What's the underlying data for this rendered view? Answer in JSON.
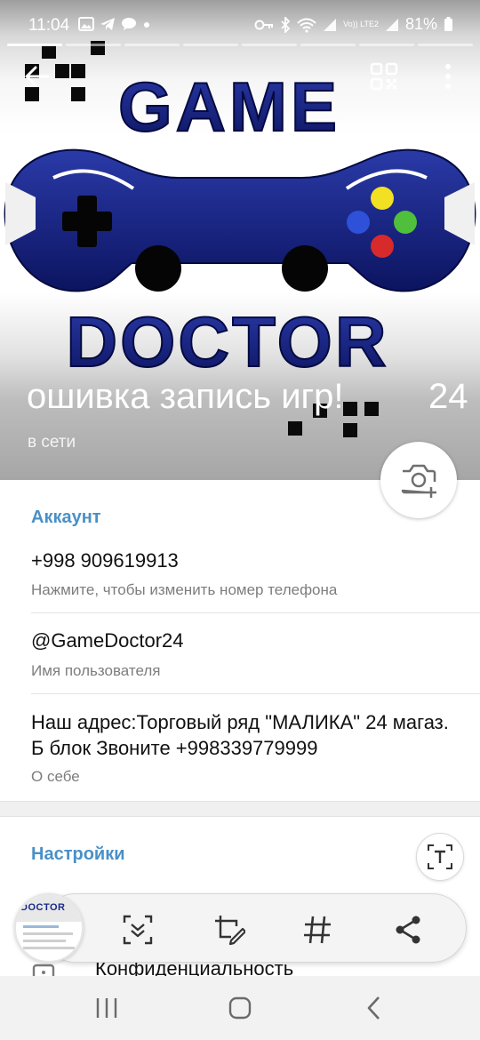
{
  "status_bar": {
    "time": "11:04",
    "battery": "81%",
    "network_label": "Vo)) LTE2"
  },
  "header": {
    "logo_text_top": "GAME",
    "logo_text_bottom": "DOCTOR",
    "name": "ошивка запись игр!",
    "name_suffix": "24",
    "status": "в сети",
    "colors": {
      "logo_blue": "#1a2a8a",
      "accent": "#4a90c8"
    }
  },
  "account": {
    "title": "Аккаунт",
    "phone": "+998 909619913",
    "phone_hint": "Нажмите, чтобы изменить номер телефона",
    "username": "@GameDoctor24",
    "username_label": "Имя пользователя",
    "bio": "Наш адрес:Торговый ряд \"МАЛИКА\" 24 магаз. Б блок Звоните +998339779999",
    "bio_label": "О себе"
  },
  "settings": {
    "title": "Настройки",
    "privacy_label": "Конфиденциальность"
  },
  "toolbar": {
    "thumbnail_text": "DOCTOR",
    "icons": [
      "scroll-capture-icon",
      "crop-edit-icon",
      "hashtag-icon",
      "share-icon"
    ]
  },
  "navbar": {
    "icons": [
      "recent-apps-icon",
      "home-icon",
      "back-icon"
    ]
  }
}
